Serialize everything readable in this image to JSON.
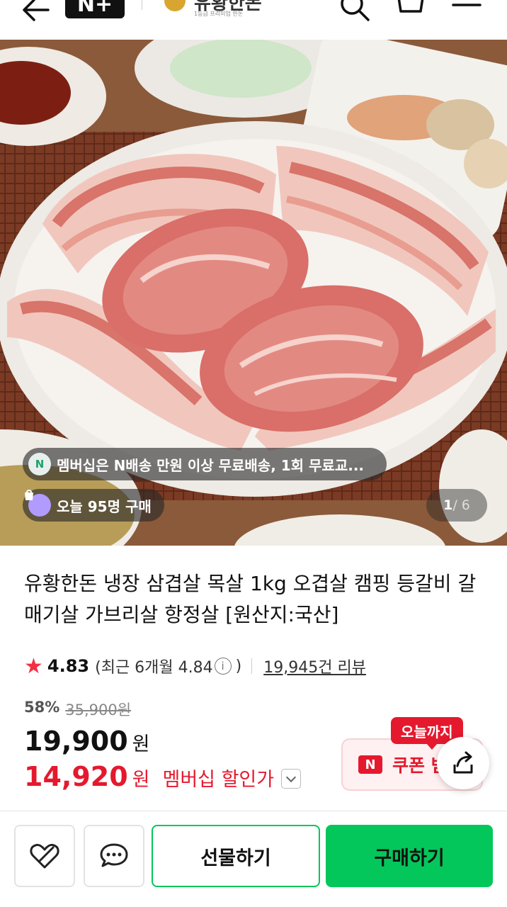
{
  "header": {
    "back_icon": "arrow-left-icon",
    "nplus_label": "N+",
    "brand_name": "유황한돈",
    "brand_sub": "1등급 프리미엄 한돈",
    "search_icon": "search-icon",
    "cart_icon": "cart-icon",
    "menu_icon": "hamburger-menu-icon"
  },
  "hero": {
    "membership_chip_text": "멤버십은 N배송 만원 이상 무료배송, 1회 무료교...",
    "membership_chip_icon": "N",
    "today_chip_text": "오늘 95명 구매",
    "page_current": "1",
    "page_total": " / 6"
  },
  "product": {
    "title": "유황한돈 냉장 삼겹살 목살 1kg 오겹살 캠핑 등갈비 갈매기살 가브리살 항정살 [원산지:국산]",
    "rating": "4.83",
    "recent_rating_text": "(최근 6개월 4.84",
    "recent_rating_close": ")",
    "reviews": "19,945건 리뷰",
    "discount_pct": "58%",
    "original_price": "35,900원",
    "price": "19,900",
    "price_unit": "원",
    "member_price": "14,920",
    "member_price_unit": "원",
    "member_label": "멤버십 할인가"
  },
  "coupon": {
    "badge": "오늘까지",
    "logo": "N",
    "text": "쿠폰 받"
  },
  "bottom_bar": {
    "gift_label": "선물하기",
    "buy_label": "구매하기"
  },
  "colors": {
    "accent_green": "#03c75a",
    "sale_red": "#e5192e",
    "star_red": "#f43142"
  }
}
